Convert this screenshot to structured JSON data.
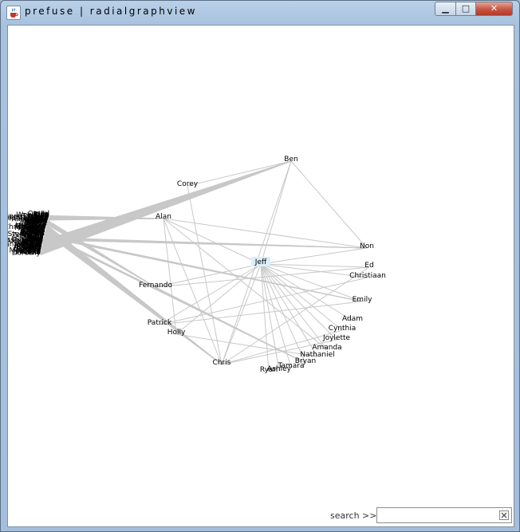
{
  "window": {
    "title": "prefuse | radialgraphview",
    "controls": {
      "minimize": "▁",
      "maximize": "□",
      "close": "✕"
    },
    "icons": {
      "app": "java-cup-icon"
    }
  },
  "search": {
    "label": "search >>",
    "value": "",
    "placeholder": ""
  },
  "colors": {
    "edge": "#c8c8c8",
    "focus_node": "#dceefa",
    "background": "#ffffff"
  },
  "graph": {
    "layout": "radial",
    "focus": "Jeff",
    "inner_nodes": [
      "Jeff",
      "Ben",
      "Corey",
      "Alan",
      "Non",
      "Fernando",
      "Ed",
      "Christiaan",
      "Emily",
      "Patrick",
      "Holly",
      "Adam",
      "Cynthia",
      "Joylette",
      "Amanda",
      "Nathaniel",
      "Bryan",
      "Tamara",
      "Ashley",
      "Ryan",
      "Chris"
    ],
    "outer_nodes": [
      "Otomi",
      "Ed",
      "Rion",
      "Nina",
      "Wen-Ting",
      "Ida",
      "Dan",
      "SuperGiggleB",
      "Micah",
      "Chuck",
      "Record Camp",
      "Diana",
      "Red",
      "JohnAnthony",
      "Jason",
      "Alexander",
      "Jory",
      "Matt",
      "Steven",
      "Micaela",
      "Shane",
      "Justin",
      "David",
      "Rikard",
      "Shane",
      "Sumit",
      "Daniel",
      "Jeremy",
      "Pete",
      "David",
      "Phil",
      "David",
      "Matthew",
      "Richard",
      "Kenji",
      "Stephen",
      "Christopher",
      "Casey",
      "Matthew",
      "Joshua",
      "Michael",
      "Sorin",
      "Sean",
      "Emily",
      "Scott",
      "Chako",
      "Katie",
      "Bob",
      "Sam",
      "Patrick",
      "Robert",
      "Marian",
      "Patrick",
      "Parker",
      "John",
      "Stephanie",
      "Calvin",
      "John",
      "Zephoria",
      "David",
      "Xz",
      "Bill",
      "kris",
      "Steve",
      "Scott",
      "Anil",
      "Matt",
      "Meg",
      "Stewart",
      "Tom",
      "Jesse James",
      "Caterina",
      "Alexander",
      "Judith",
      "Matt",
      "Kevin",
      "Justin",
      "Jane",
      "steph",
      "Jim",
      "Jeremy",
      "dan",
      "Lanna souris",
      "Brent",
      "Jennifer",
      "Michael",
      "Bnanny",
      "Young",
      "Charlie",
      "Mike",
      "Jonah",
      "Erin",
      "Jennifer",
      "Lowell",
      "Ty",
      "Eric",
      "Mary",
      "Meredith",
      "sarah",
      "Joanna",
      "Evan",
      "Michael",
      "Rania",
      "Nels",
      "Dorothy"
    ]
  }
}
